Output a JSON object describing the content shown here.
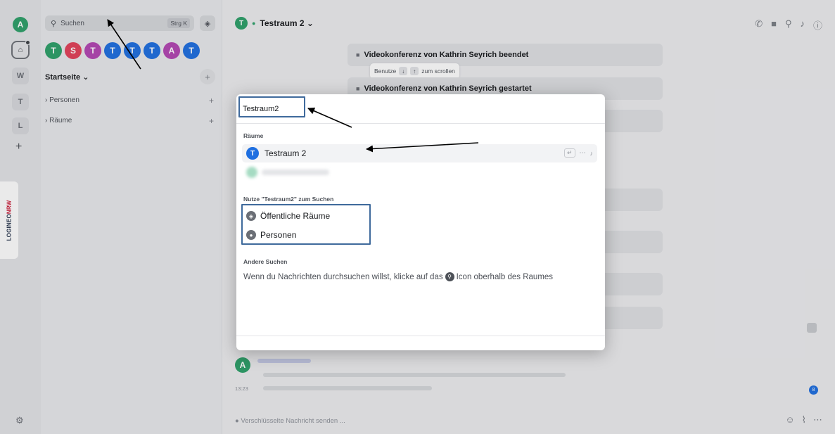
{
  "spacebar": {
    "avatar_letter": "A",
    "items": [
      "W",
      "T",
      "L"
    ]
  },
  "roomlist": {
    "search_placeholder": "Suchen",
    "search_shortcut": "Strg K",
    "recents": [
      {
        "letter": "T",
        "color": "#2da069"
      },
      {
        "letter": "S",
        "color": "#e2415a"
      },
      {
        "letter": "T",
        "color": "#b346b3"
      },
      {
        "letter": "T",
        "color": "#1f6fe0"
      },
      {
        "letter": "T",
        "color": "#1f6fe0"
      },
      {
        "letter": "T",
        "color": "#1f6fe0"
      },
      {
        "letter": "A",
        "color": "#b346b3"
      },
      {
        "letter": "T",
        "color": "#1f6fe0"
      }
    ],
    "home_title": "Startseite ⌄",
    "sections": {
      "people": "› Personen",
      "rooms": "› Räume"
    }
  },
  "room": {
    "avatar_letter": "T",
    "name": "Testraum 2 ⌄"
  },
  "timeline": {
    "event_ended": "Videokonferenz von Kathrin Seyrich beendet",
    "event_started": "Videokonferenz von Kathrin Seyrich gestartet",
    "scroll_hint_before": "Benutze",
    "scroll_hint_after": "zum scrollen",
    "message_avatar": "A",
    "time": "13:23",
    "unread_count": "8",
    "composer_placeholder": "Verschlüsselte Nachricht senden ..."
  },
  "dialog": {
    "query": "Testraum2",
    "rooms_heading": "Räume",
    "result": {
      "letter": "T",
      "name": "Testraum 2"
    },
    "use_heading": "Nutze \"Testraum2\" zum Suchen",
    "option_public": "Öffentliche Räume",
    "option_people": "Personen",
    "other_heading": "Andere Suchen",
    "hint_before": "Wenn du Nachrichten durchsuchen willst, klicke auf das",
    "hint_after": "Icon oberhalb des Raumes"
  },
  "colors": {
    "accent_green": "#2da069",
    "annotation_blue": "#3f6a9c"
  }
}
